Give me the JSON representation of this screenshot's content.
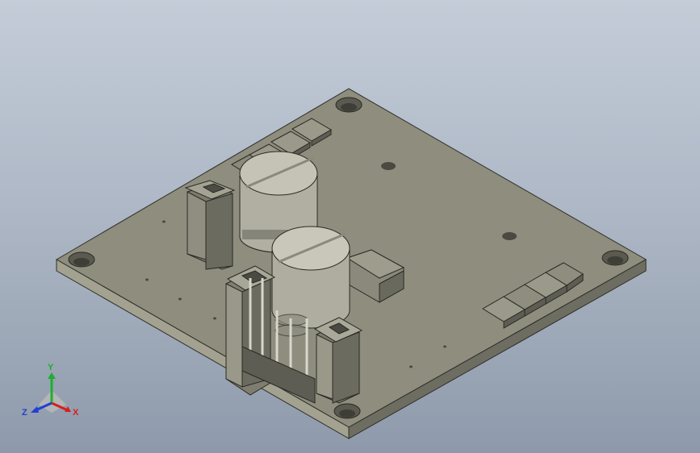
{
  "viewport": {
    "background_top": "#c4ccd8",
    "background_bottom": "#8e9aab",
    "model_color": "#8c8b7c"
  },
  "triad": {
    "x_label": "X",
    "y_label": "Y",
    "z_label": "Z",
    "x_color": "#d81e1e",
    "y_color": "#1fae2e",
    "z_color": "#2040d0"
  }
}
